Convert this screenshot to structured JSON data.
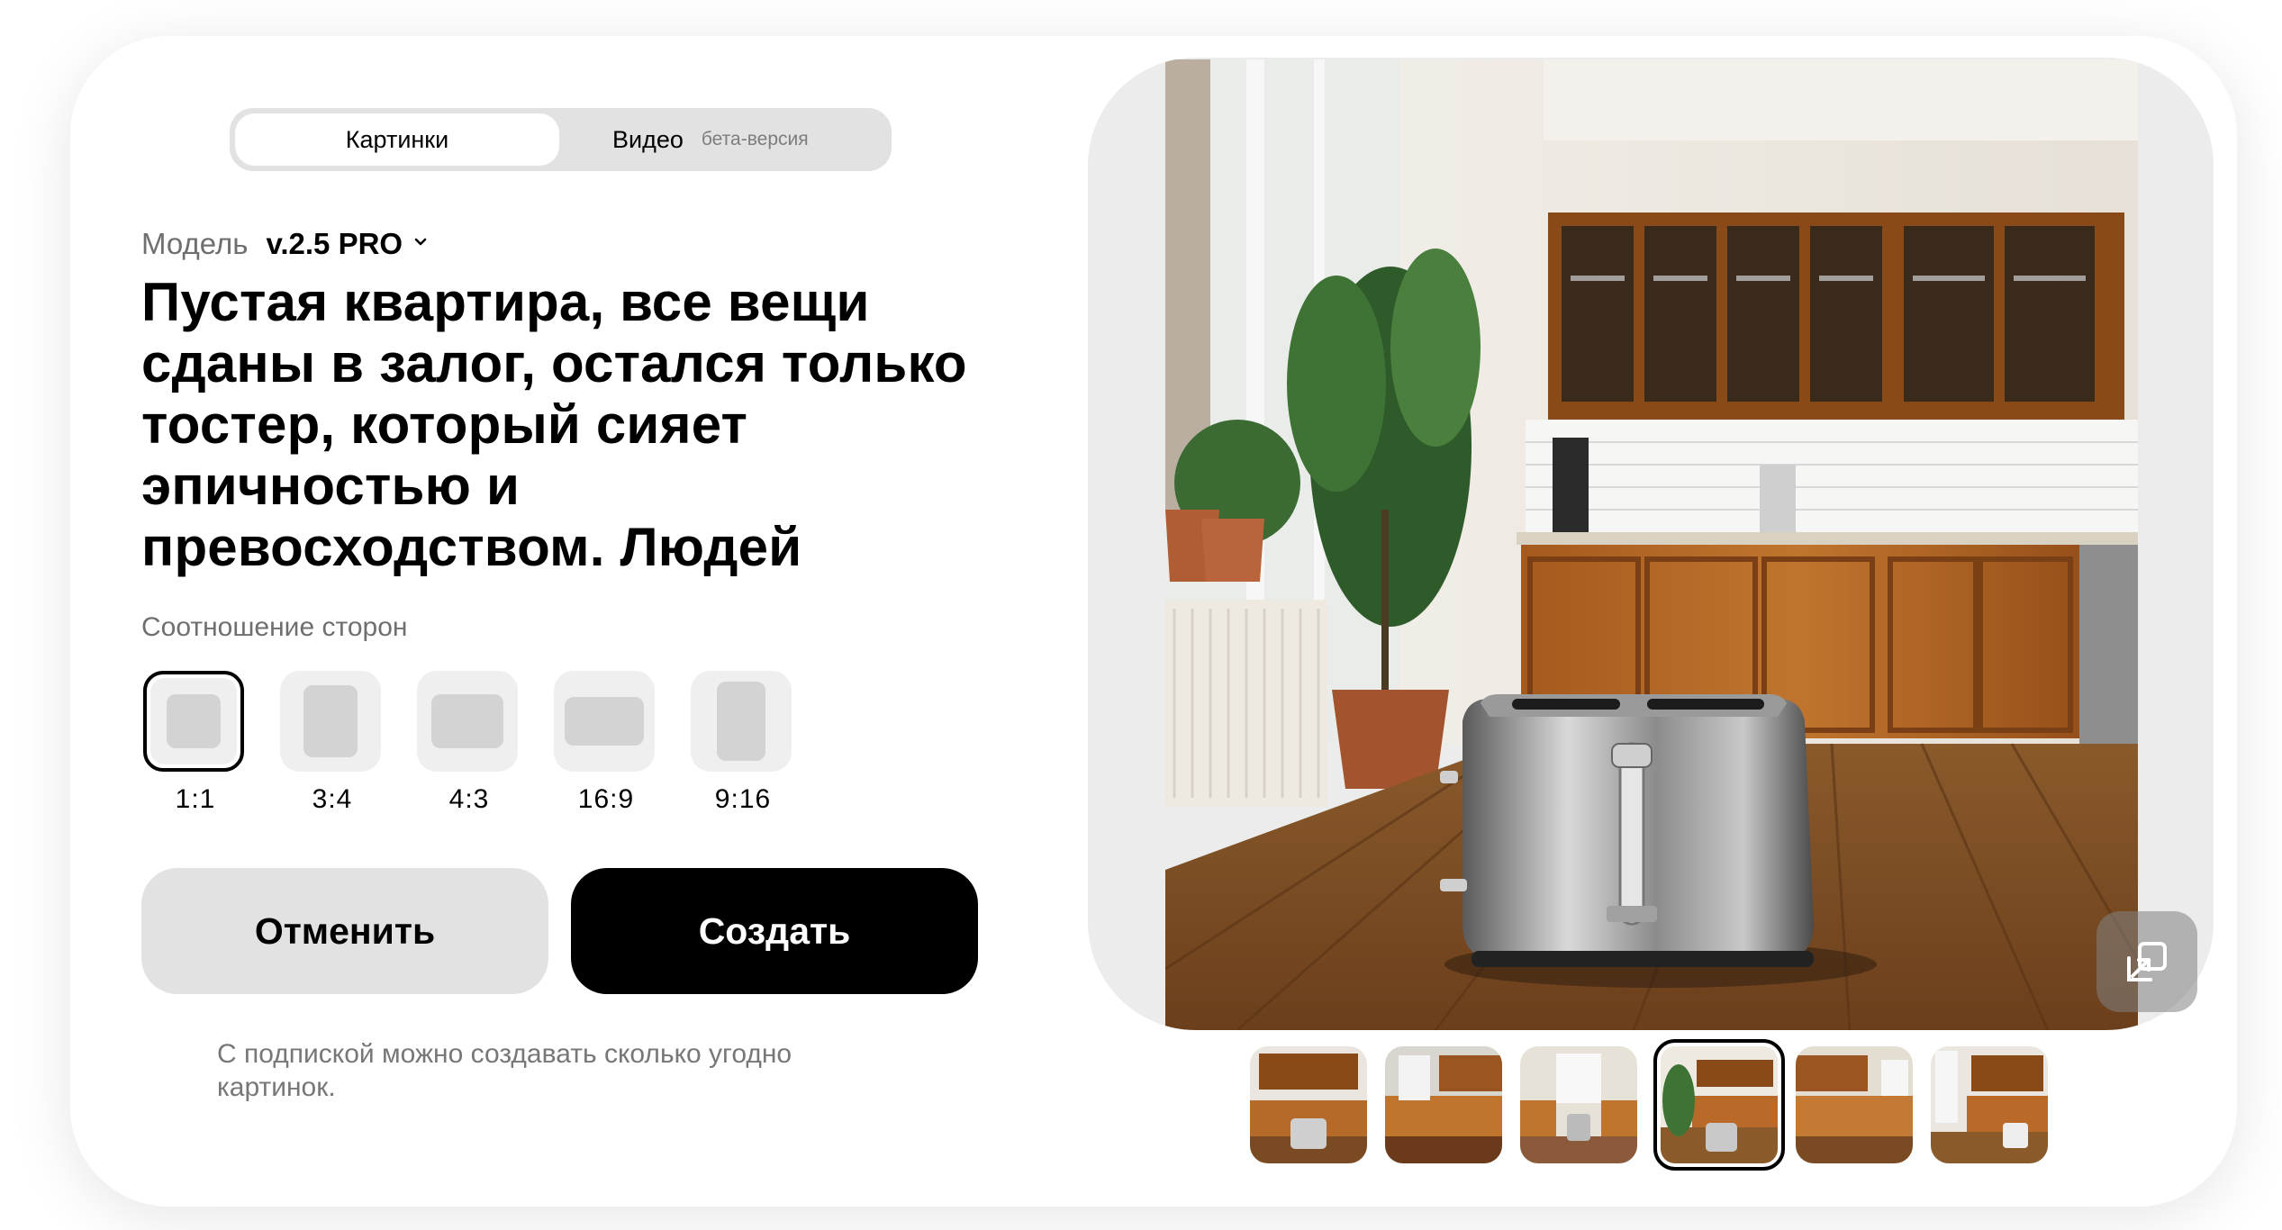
{
  "mode_tabs": {
    "images_label": "Картинки",
    "video_label": "Видео",
    "video_badge": "бета-версия"
  },
  "model": {
    "label": "Модель",
    "value": "v.2.5 PRO"
  },
  "prompt_text": "Пустая квартира, все вещи сданы в залог, остался только тостер, который сияет эпичностью и превосходством. Людей",
  "aspect_ratio": {
    "label": "Соотношение сторон",
    "options": [
      "1:1",
      "3:4",
      "4:3",
      "16:9",
      "9:16"
    ],
    "selected": "1:1"
  },
  "actions": {
    "cancel_label": "Отменить",
    "create_label": "Создать"
  },
  "subscription_note": "С подпиской можно создавать сколько угодно картинок.",
  "preview": {
    "expand_icon": "expand-icon",
    "thumbnail_count": 6,
    "selected_thumbnail": 4
  },
  "colors": {
    "accent": "#000000",
    "secondary_button": "#e2e2e2",
    "muted_text": "#6f6f6f"
  }
}
